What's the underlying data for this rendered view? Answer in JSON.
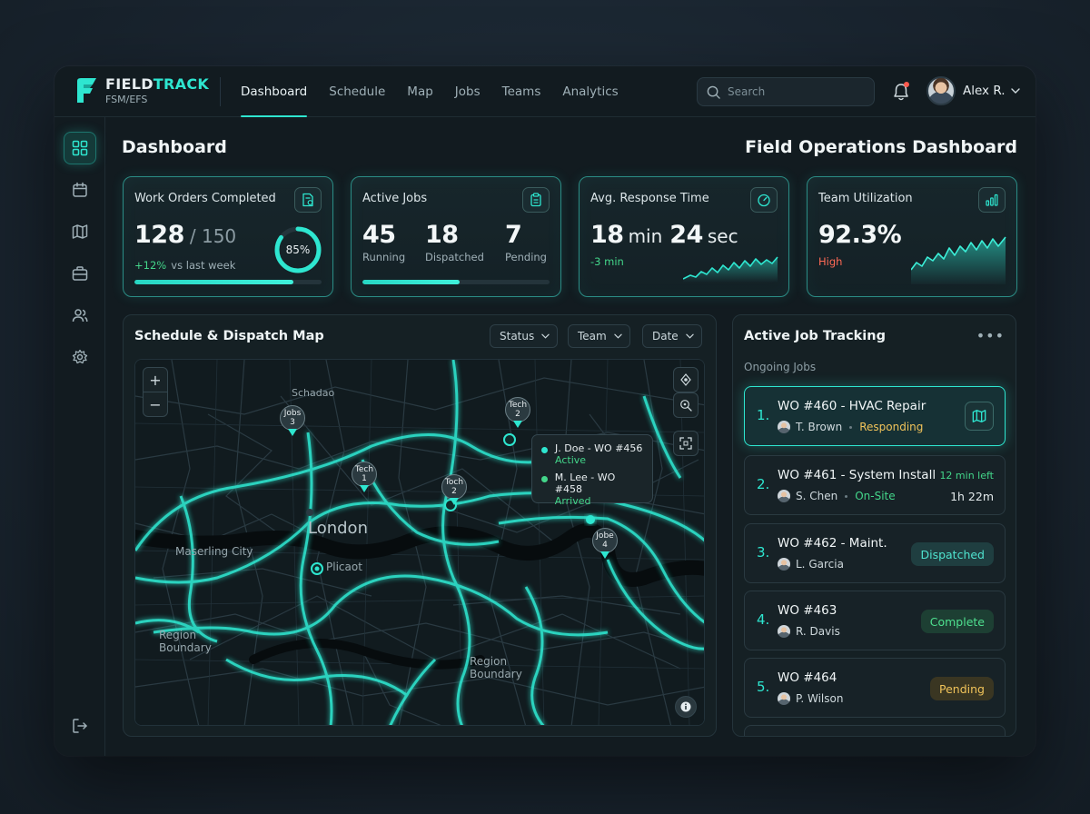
{
  "brand": {
    "name_a": "FIELD",
    "name_b": "TRACK",
    "sub": "FSM/EFS",
    "accent": "#2ee6d0"
  },
  "nav": [
    {
      "label": "Dashboard",
      "active": true
    },
    {
      "label": "Schedule"
    },
    {
      "label": "Map"
    },
    {
      "label": "Jobs"
    },
    {
      "label": "Teams"
    },
    {
      "label": "Analytics"
    }
  ],
  "search": {
    "placeholder": "Search"
  },
  "user": {
    "name": "Alex R."
  },
  "sidebar_icons": [
    "dashboard-grid-icon",
    "calendar-icon",
    "map-icon",
    "briefcase-icon",
    "users-icon",
    "settings-icon",
    "logout-icon"
  ],
  "page": {
    "title": "Dashboard",
    "title_right": "Field Operations Dashboard"
  },
  "stats": {
    "work_orders": {
      "title": "Work Orders Completed",
      "value": "128",
      "total": "/ 150",
      "delta": "+12%",
      "delta_text": "vs last week",
      "percent_label": "85%",
      "percent": 0.85
    },
    "active_jobs": {
      "title": "Active Jobs",
      "running": "45",
      "running_label": "Running",
      "dispatched": "18",
      "dispatched_label": "Dispatched",
      "pending": "7",
      "pending_label": "Pending",
      "progress": 0.52
    },
    "response": {
      "title": "Avg. Response Time",
      "min_value": "18",
      "min_unit": "min",
      "sec_value": "24",
      "sec_unit": "sec",
      "delta": "-3 min"
    },
    "utilization": {
      "title": "Team Utilization",
      "value": "92.3%",
      "level": "High"
    }
  },
  "map_panel": {
    "title": "Schedule & Dispatch Map",
    "filters": [
      "Status",
      "Team",
      "Date"
    ],
    "labels": {
      "city": "London",
      "north": "Schadao",
      "west": "Maserling City",
      "center_south": "Plicaot",
      "region_sw_a": "Region",
      "region_sw_b": "Boundary",
      "region_s_a": "Region",
      "region_s_b": "Boundary"
    },
    "pins": [
      {
        "line1": "Jobs",
        "line2": "3"
      },
      {
        "line1": "Tech",
        "line2": "2"
      },
      {
        "line1": "Tech",
        "line2": "1"
      },
      {
        "line1": "Toch",
        "line2": "2"
      },
      {
        "line1": "Jobe",
        "line2": "4"
      }
    ],
    "tooltip": [
      {
        "name": "J. Doe - WO #456",
        "status": "Active"
      },
      {
        "name": "M. Lee - WO #458",
        "status": "Arrived"
      }
    ]
  },
  "jobs_panel": {
    "title": "Active Job Tracking",
    "subtitle": "Ongoing Jobs",
    "jobs": [
      {
        "num": "1.",
        "title": "WO #460 - HVAC Repair",
        "person": "T. Brown",
        "status": "Responding"
      },
      {
        "num": "2.",
        "title": "WO #461 - System Install",
        "time_left": "12 min left",
        "person": "S. Chen",
        "status": "On-Site",
        "duration": "1h 22m"
      },
      {
        "num": "3.",
        "title": "WO #462 - Maint.",
        "person": "L. Garcia",
        "badge": "Dispatched"
      },
      {
        "num": "4.",
        "title": "WO #463",
        "person": "R. Davis",
        "badge": "Complete"
      },
      {
        "num": "5.",
        "title": "WO #464",
        "person": "P. Wilson",
        "badge": "Pending"
      }
    ]
  }
}
